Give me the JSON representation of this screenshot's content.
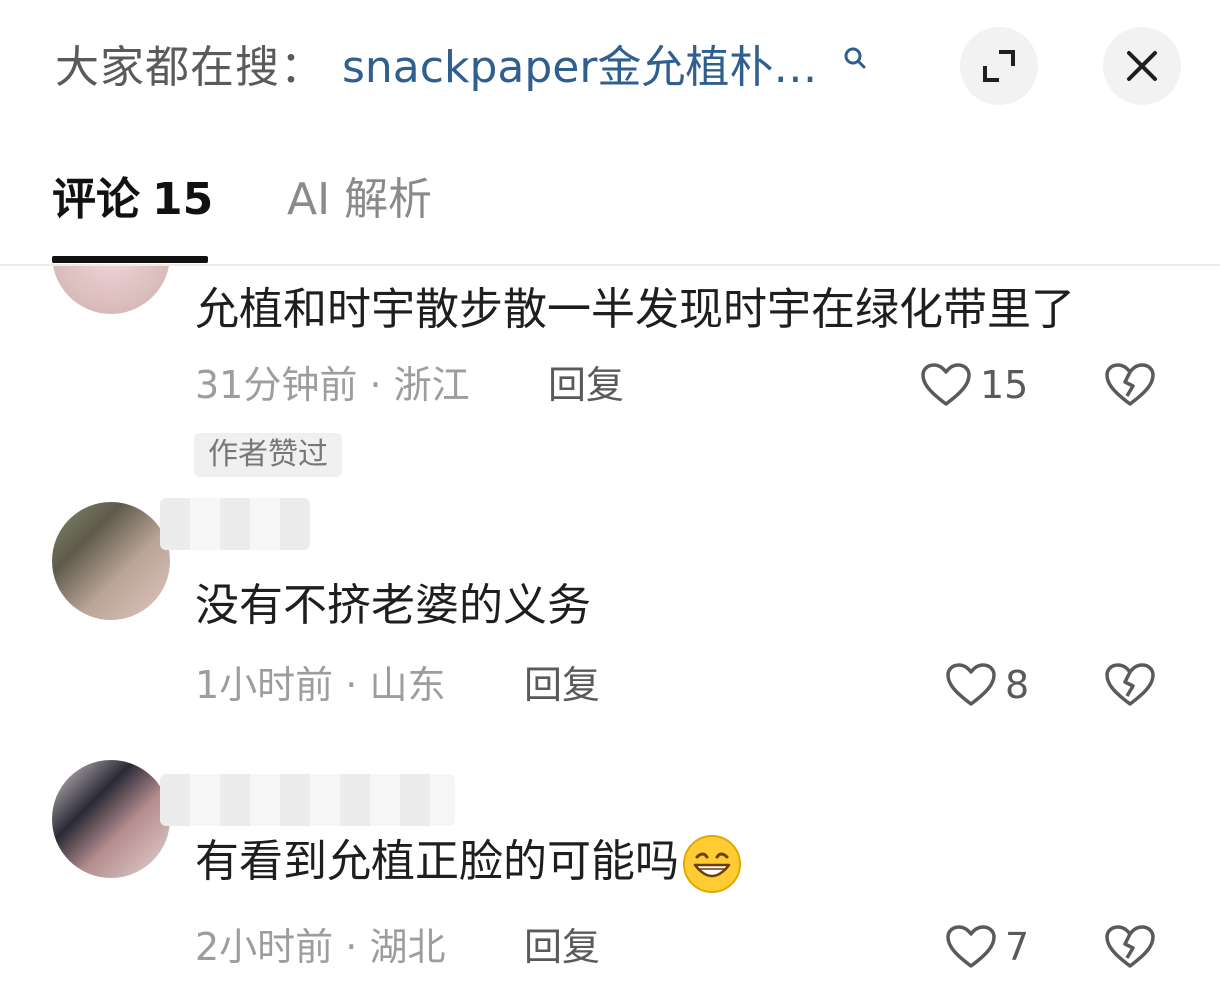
{
  "header": {
    "search_prefix": "大家都在搜：",
    "search_query": "snackpaper金允植朴…",
    "expand_icon": "expand-icon",
    "close_icon": "close-icon"
  },
  "tabs": [
    {
      "label": "评论",
      "count": "15",
      "active": true
    },
    {
      "label": "AI 解析",
      "active": false
    }
  ],
  "comments": [
    {
      "text": "允植和时宇散步散一半发现时宇在绿化带里了",
      "time": "31分钟前",
      "location": "浙江",
      "reply_label": "回复",
      "likes": "15",
      "badge": "作者赞过"
    },
    {
      "text": "没有不挤老婆的义务",
      "time": "1小时前",
      "location": "山东",
      "reply_label": "回复",
      "likes": "8"
    },
    {
      "text": "有看到允植正脸的可能吗",
      "emoji": "grinning-face-emoji",
      "time": "2小时前",
      "location": "湖北",
      "reply_label": "回复",
      "likes": "7"
    }
  ],
  "colors": {
    "link": "#2f5f8f",
    "meta": "#9d9d9d",
    "tab_active": "#111111",
    "tab_inactive": "#8a8a8a"
  }
}
